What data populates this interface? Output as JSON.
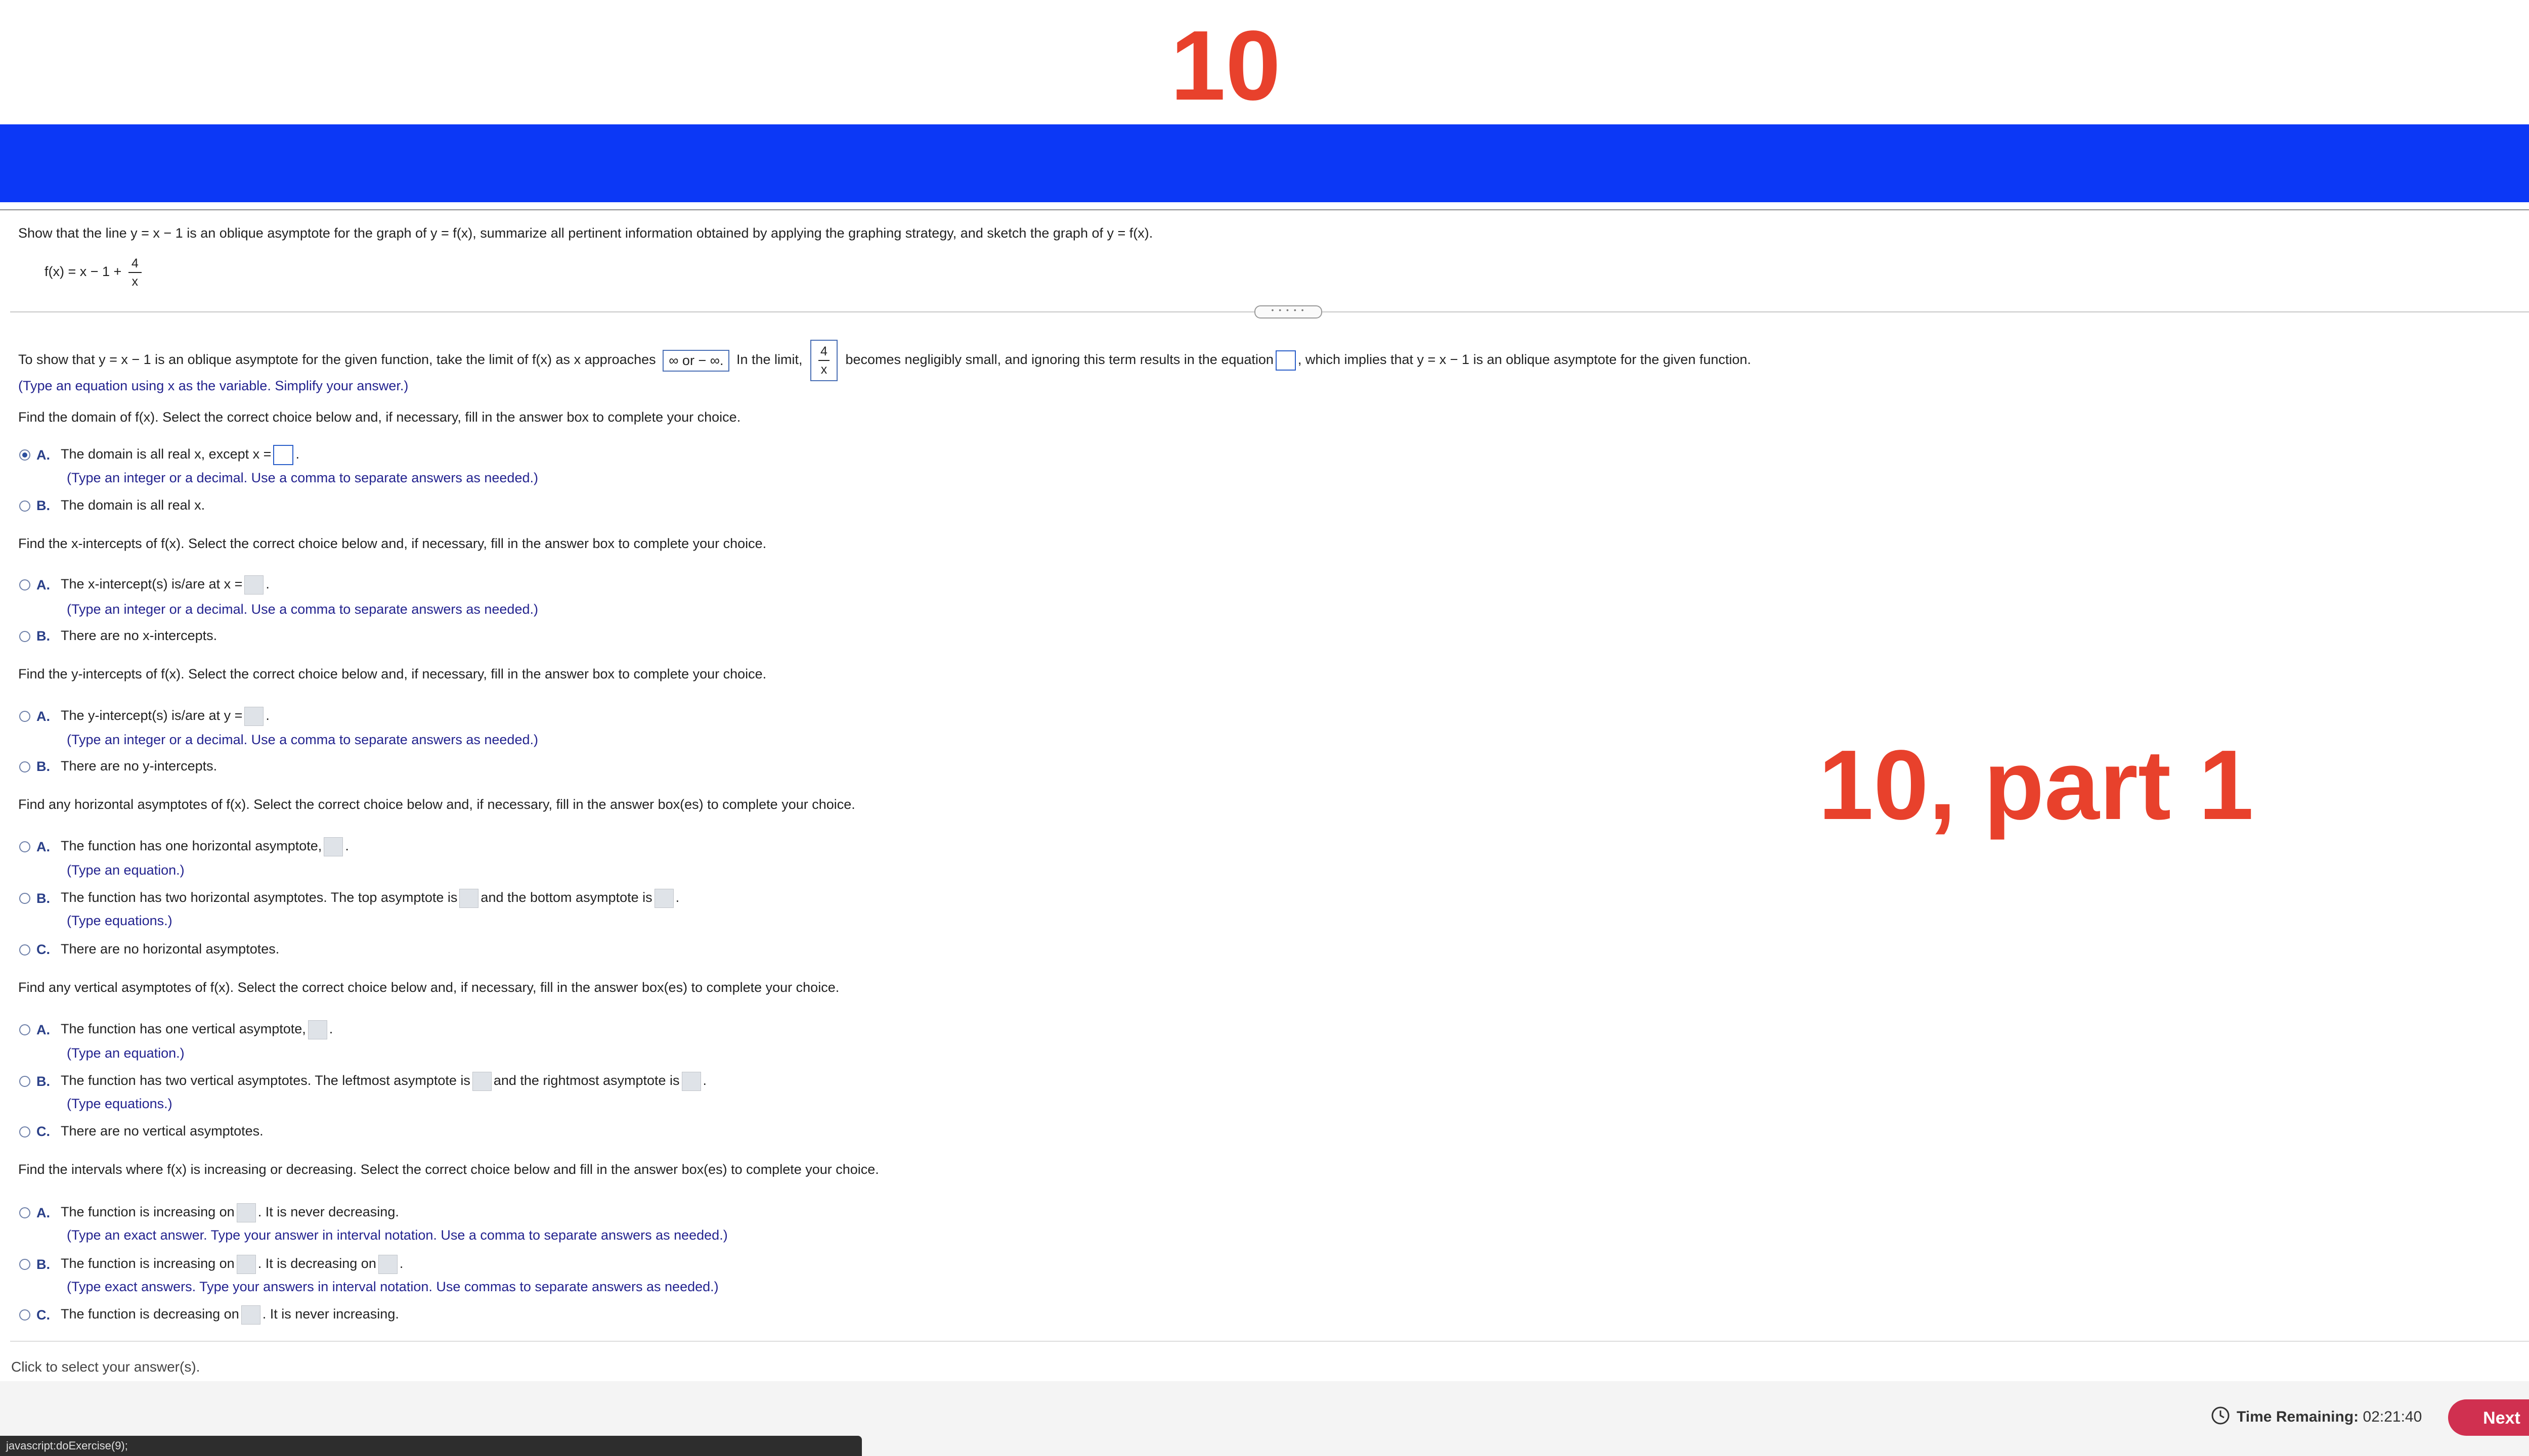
{
  "header": {
    "number": "10",
    "part_label": "10, part 1"
  },
  "problem": {
    "statement": "Show that the line y = x − 1 is an oblique asymptote for the graph of y = f(x), summarize all pertinent information obtained by applying the graphing strategy, and sketch the graph of y = f(x).",
    "func_prefix": "f(x) = x − 1 +",
    "func_num": "4",
    "func_den": "x"
  },
  "splitter": {
    "dots": "• • • • •"
  },
  "limit_step": {
    "pre": "To show that y = x − 1 is an oblique asymptote for the given function, take the limit of f(x) as x approaches",
    "select_value": "∞ or − ∞.",
    "mid": "In the limit,",
    "frac_num": "4",
    "frac_den": "x",
    "post1": "becomes negligibly small, and ignoring this term results in the equation",
    "post2": ", which implies that y = x − 1 is an oblique asymptote for the given function.",
    "hint": "(Type an equation using x as the variable. Simplify your answer.)"
  },
  "domain": {
    "prompt": "Find the domain of f(x). Select the correct choice below and, if necessary, fill in the answer box to complete your choice.",
    "a_letter": "A.",
    "a_text": "The domain is all real x, except x =",
    "a_end": ".",
    "a_hint": "(Type an integer or a decimal. Use a comma to separate answers as needed.)",
    "b_letter": "B.",
    "b_text": "The domain is all real x."
  },
  "xint": {
    "prompt": "Find the x-intercepts of f(x). Select the correct choice below and, if necessary, fill in the answer box to complete your choice.",
    "a_letter": "A.",
    "a_text": "The x-intercept(s) is/are at x =",
    "a_end": ".",
    "a_hint": "(Type an integer or a decimal. Use a comma to separate answers as needed.)",
    "b_letter": "B.",
    "b_text": "There are no x-intercepts."
  },
  "yint": {
    "prompt": "Find the y-intercepts of f(x). Select the correct choice below and, if necessary, fill in the answer box to complete your choice.",
    "a_letter": "A.",
    "a_text": "The y-intercept(s) is/are at y =",
    "a_end": ".",
    "a_hint": "(Type an integer or a decimal. Use a comma to separate answers as needed.)",
    "b_letter": "B.",
    "b_text": "There are no y-intercepts."
  },
  "hasym": {
    "prompt": "Find any horizontal asymptotes of f(x). Select the correct choice below and, if necessary, fill in the answer box(es) to complete your choice.",
    "a_letter": "A.",
    "a_text": "The function has one horizontal asymptote,",
    "a_end": ".",
    "a_hint": "(Type an equation.)",
    "b_letter": "B.",
    "b_text1": "The function has two horizontal asymptotes. The top asymptote is",
    "b_text2": "and the bottom asymptote is",
    "b_end": ".",
    "b_hint": "(Type equations.)",
    "c_letter": "C.",
    "c_text": "There are no horizontal asymptotes."
  },
  "vasym": {
    "prompt": "Find any vertical asymptotes of f(x). Select the correct choice below and, if necessary, fill in the answer box(es) to complete your choice.",
    "a_letter": "A.",
    "a_text": "The function has one vertical asymptote,",
    "a_end": ".",
    "a_hint": "(Type an equation.)",
    "b_letter": "B.",
    "b_text1": "The function has two vertical asymptotes. The leftmost asymptote is",
    "b_text2": "and the rightmost asymptote is",
    "b_end": ".",
    "b_hint": "(Type equations.)",
    "c_letter": "C.",
    "c_text": "There are no vertical asymptotes."
  },
  "incdec": {
    "prompt": "Find the intervals where f(x) is increasing or decreasing. Select the correct choice below and fill in the answer box(es) to complete your choice.",
    "a_letter": "A.",
    "a_text1": "The function is increasing on",
    "a_text2": ". It is never decreasing.",
    "a_hint": "(Type an exact answer. Type your answer in interval notation. Use a comma to separate answers as needed.)",
    "b_letter": "B.",
    "b_text1": "The function is increasing on",
    "b_text2": ". It is decreasing on",
    "b_end": ".",
    "b_hint": "(Type exact answers. Type your answers in interval notation. Use commas to separate answers as needed.)",
    "c_letter": "C.",
    "c_text1": "The function is decreasing on",
    "c_text2": ". It is never increasing."
  },
  "footer": {
    "click_hint": "Click to select your answer(s).",
    "time_label": "Time Remaining:",
    "time_value": "02:21:40",
    "next_label": "Next",
    "status_text": "javascript:doExercise(9);"
  },
  "colors": {
    "accent_red": "#e8412c",
    "bar_blue": "#0c38f6",
    "next_button": "#d03050"
  }
}
